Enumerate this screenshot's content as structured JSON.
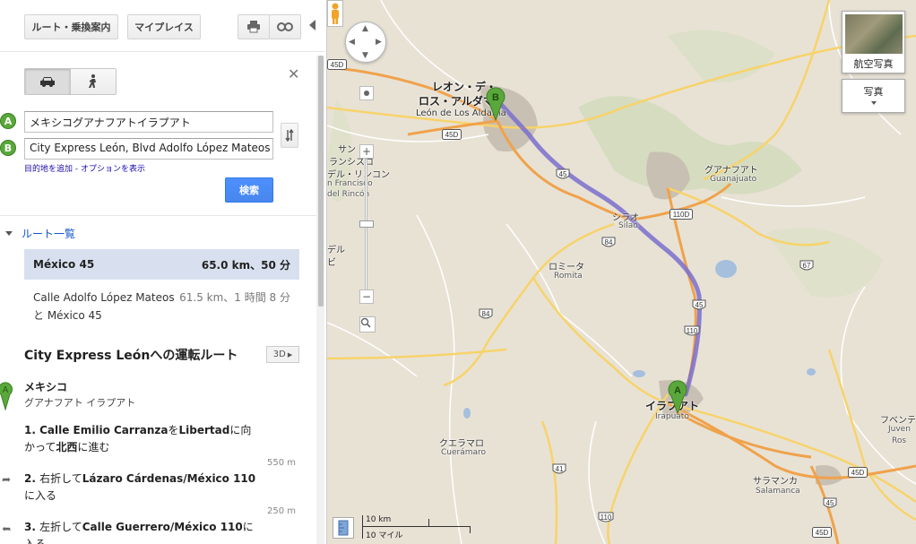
{
  "toolbar": {
    "directions_label": "ルート・乗換案内",
    "my_places_label": "マイプレイス",
    "print_icon": "print-icon",
    "link_icon": "link-icon"
  },
  "modes": {
    "car": "car-icon",
    "walk": "walk-icon",
    "selected": "car"
  },
  "form": {
    "origin_marker": "A",
    "origin_value": "メキシコグアナフアトイラプアト",
    "destination_marker": "B",
    "destination_value": "City Express León, Blvd Adolfo López Mateos",
    "add_destination": "目的地を追加",
    "separator": " - ",
    "show_options": "オプションを表示",
    "search_label": "検索"
  },
  "routes": {
    "header": "ルート一覧",
    "items": [
      {
        "name": "México 45",
        "summary": "65.0 km、50 分"
      },
      {
        "name": "Calle Adolfo López Mateos",
        "name2": "と México 45",
        "summary": "61.5 km、1 時間 8 分"
      }
    ]
  },
  "directions": {
    "title": "City Express Leónへの運転ルート",
    "btn_3d": "3D",
    "start_marker": "A",
    "start_name": "メキシコ",
    "start_sub": "グアナフアト イラプアト",
    "steps": [
      {
        "pre": "1. Calle Emilio Carranza",
        "mid": "を",
        "bold2": "Libertad",
        "post": "に向かって",
        "bold3": "北西",
        "post2": "に進む",
        "distance": "550 m"
      },
      {
        "pre": "2. ",
        "text": "右折して",
        "bold": "Lázaro Cárdenas/México 110",
        "post": "に入る",
        "distance": "250 m"
      },
      {
        "pre": "3. ",
        "text": "左折して",
        "bold": "Calle Guerrero/México 110",
        "post": "に入る"
      }
    ]
  },
  "map": {
    "pan_icon": "pan-control-icon",
    "zoom_in": "+",
    "zoom_out": "−",
    "satellite_label": "航空写真",
    "photo_label": "写真",
    "scale_km": "10 km",
    "scale_mi": "10 マイル",
    "marker_a": "A",
    "marker_b": "B",
    "labels": [
      {
        "id": "leon-ja",
        "text": "レオン・デ・"
      },
      {
        "id": "leon-ja2",
        "text": "ロス・アルダマ"
      },
      {
        "id": "leon-es",
        "text": "León de Los Aldama"
      },
      {
        "id": "sanfrancisco-ja1",
        "text": "サン"
      },
      {
        "id": "sanfrancisco-ja2",
        "text": "ランシスコ"
      },
      {
        "id": "sanfrancisco-ja3",
        "text": "デル・リンコン"
      },
      {
        "id": "sanfrancisco-es1",
        "text": "n Francisco"
      },
      {
        "id": "sanfrancisco-es2",
        "text": "del Rincón"
      },
      {
        "id": "guanajuato-ja",
        "text": "グアナフアト"
      },
      {
        "id": "guanajuato-es",
        "text": "Guanajuato"
      },
      {
        "id": "silao-ja",
        "text": "シラオ"
      },
      {
        "id": "silao-es",
        "text": "Silao"
      },
      {
        "id": "romita-ja",
        "text": "ロミータ"
      },
      {
        "id": "romita-es",
        "text": "Romita"
      },
      {
        "id": "irapuato-ja",
        "text": "イラプアト"
      },
      {
        "id": "irapuato-es",
        "text": "Irapuato"
      },
      {
        "id": "cueramaro-ja",
        "text": "クエラマロ"
      },
      {
        "id": "cueramaro-es",
        "text": "Cuerámaro"
      },
      {
        "id": "salamanca-ja",
        "text": "サラマンカ"
      },
      {
        "id": "salamanca-es",
        "text": "Salamanca"
      },
      {
        "id": "juventino-ja",
        "text": "フベンティ"
      },
      {
        "id": "juventino-es1",
        "text": "Juven"
      },
      {
        "id": "juventino-es2",
        "text": "Ros"
      },
      {
        "id": "del-ja",
        "text": "デル"
      },
      {
        "id": "bi-ja",
        "text": "ビ"
      }
    ],
    "shields": [
      "45D",
      "45D",
      "45",
      "110D",
      "84",
      "45",
      "110",
      "84",
      "67",
      "41",
      "110",
      "45D",
      "45",
      "45D"
    ]
  }
}
